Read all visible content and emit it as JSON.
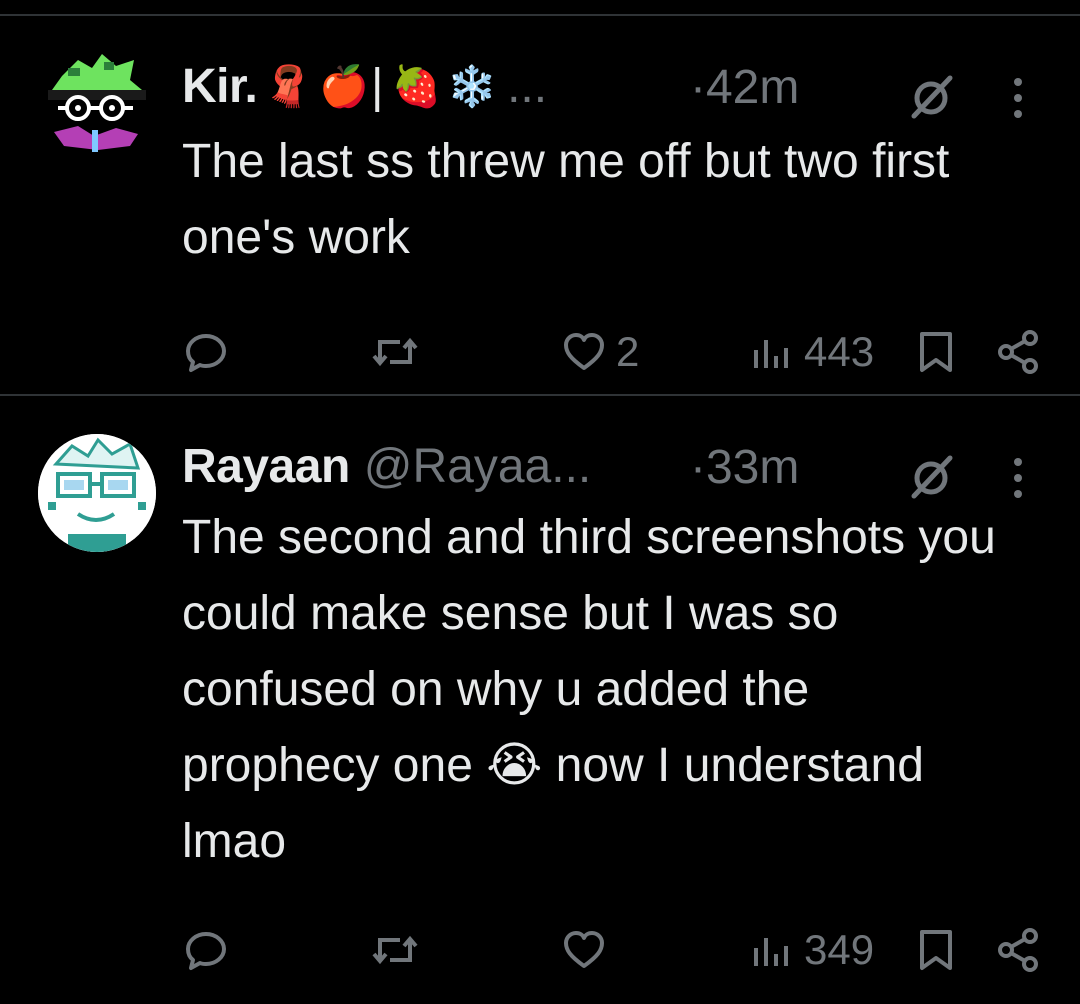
{
  "tweets": [
    {
      "name": "Kir.",
      "name_emojis": [
        "🧣",
        "🍎"
      ],
      "separator": "|",
      "name_emojis_2": [
        "🍓",
        "❄️"
      ],
      "ellipsis": "...",
      "handle": "",
      "time": "·42m",
      "text": "The last ss threw me off but two first one's work",
      "replies": "",
      "retweets": "",
      "likes": "2",
      "views": "443",
      "avatar_colors": {
        "hair": "#6ee35f",
        "scarf": "#b43fb5"
      }
    },
    {
      "name": "Rayaan",
      "handle": "@Rayaa...",
      "time": "·33m",
      "text": "The second and third screenshots you could make sense but I was so confused on why u added the prophecy one 😭 now I understand lmao",
      "replies": "",
      "retweets": "",
      "likes": "",
      "views": "349",
      "avatar_colors": {
        "bg": "#ffffff",
        "accent": "#2f9e93"
      }
    }
  ],
  "icons": [
    "reply-icon",
    "retweet-icon",
    "like-icon",
    "views-icon",
    "bookmark-icon",
    "share-icon",
    "grok-icon",
    "more-icon"
  ],
  "colors": {
    "background": "#000000",
    "text": "#e7e9ea",
    "muted": "#71767b",
    "divider": "#2f3336"
  }
}
